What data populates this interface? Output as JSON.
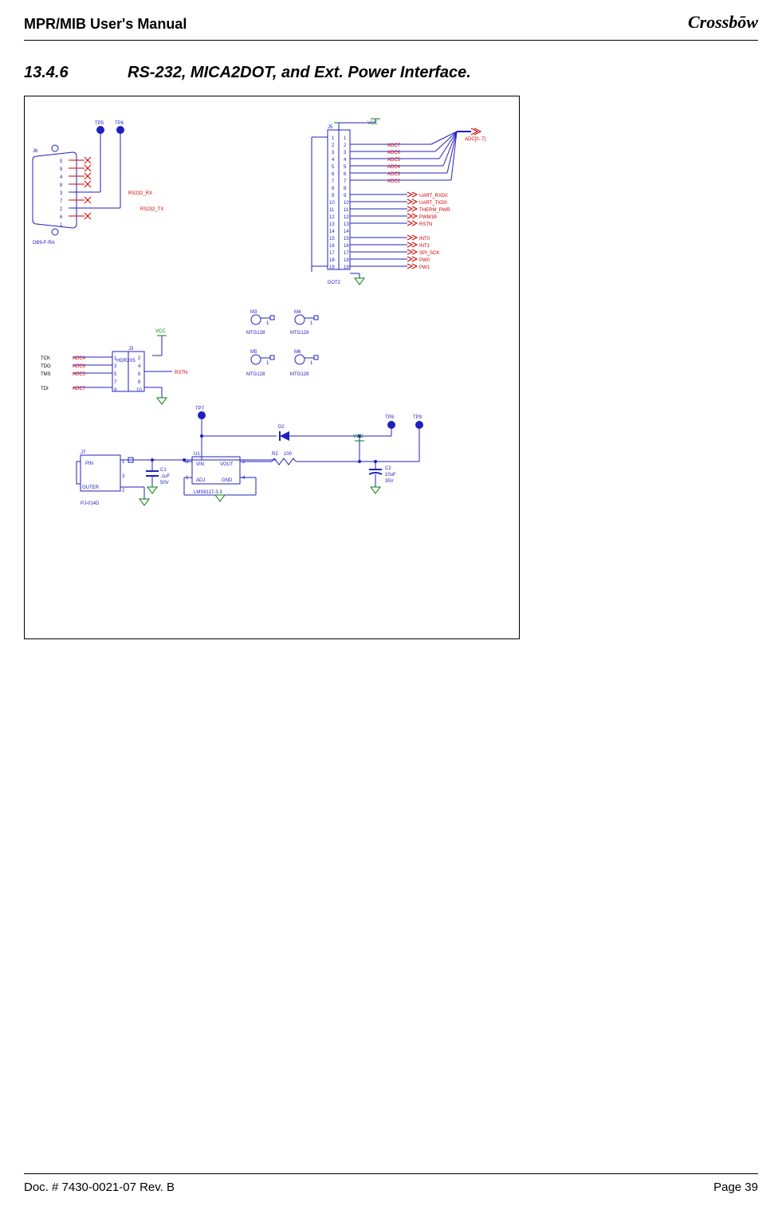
{
  "header": {
    "title": "MPR/MIB User's Manual",
    "logo": "Crossbōw"
  },
  "section": {
    "number": "13.4.6",
    "title": "RS-232, MICA2DOT, and Ext. Power Interface."
  },
  "footer": {
    "left": "Doc. # 7430-0021-07 Rev. B",
    "right": "Page 39"
  },
  "schematic": {
    "db9": {
      "ref": "J6",
      "partname": "DB9-F-RA",
      "pins": [
        "5",
        "9",
        "4",
        "8",
        "3",
        "7",
        "2",
        "6",
        "1"
      ]
    },
    "rs232": {
      "rx": "RS232_RX",
      "tx": "RS232_TX"
    },
    "tp": {
      "tp5": "TP5",
      "tp6": "TP6",
      "tp7": "TP7",
      "tp8": "TP8",
      "tp9": "TP9"
    },
    "j5": {
      "ref": "J5",
      "partname": "DOT2",
      "vcc": "VCC",
      "left_pins": [
        "1",
        "2",
        "3",
        "4",
        "5",
        "6",
        "7",
        "8",
        "9",
        "10",
        "11",
        "12",
        "13",
        "14",
        "15",
        "16",
        "17",
        "18",
        "19"
      ],
      "right_pins": [
        "1",
        "2",
        "3",
        "4",
        "5",
        "6",
        "7",
        "8",
        "9",
        "10",
        "11",
        "12",
        "13",
        "14",
        "15",
        "16",
        "17",
        "18",
        "19"
      ],
      "nets": {
        "adc7": "ADC7",
        "adc6": "ADC6",
        "adc5": "ADC5",
        "adc4": "ADC4",
        "adc3": "ADC3",
        "adc2": "ADC2",
        "uart_rxd0": "UART_RXD0",
        "uart_txd0": "UART_TXD0",
        "therm_pwr": "THERM_PWR",
        "pwm1b": "PWM1B",
        "rstn": "RSTN",
        "int0": "INT0",
        "int1": "INT1",
        "spi_sck": "SPI_SCK",
        "pw0": "PW0",
        "pw1": "PW1"
      },
      "bus": "ADC[0..7]"
    },
    "j3": {
      "ref": "J3",
      "partname": "HDR2X5",
      "vcc": "VCC",
      "jtag": {
        "tck": "TCK",
        "tdo": "TDO",
        "tms": "TMS",
        "tdi": "TDI"
      },
      "adc": {
        "adc4": "ADC4",
        "adc6": "ADC6",
        "adc5": "ADC5",
        "adc7": "ADC7"
      },
      "pins_l": [
        "1",
        "3",
        "5",
        "7",
        "9"
      ],
      "pins_r": [
        "2",
        "4",
        "6",
        "8",
        "10"
      ],
      "rstn": "RSTN"
    },
    "mtg": {
      "refs": [
        "M3",
        "M4",
        "M5",
        "M6"
      ],
      "part": "MTG128",
      "pin": "1"
    },
    "power": {
      "j7": {
        "ref": "J7",
        "partname": "PJ-014D",
        "pin_labels": {
          "pin": "PIN",
          "outer": "OUTER"
        },
        "pins": [
          "1",
          "3",
          "2"
        ]
      },
      "d2": {
        "ref": "D2"
      },
      "c1": {
        "ref": "C1",
        "val": ".1uF",
        "volt": "50V"
      },
      "u1": {
        "ref": "U1",
        "part": "LMS8117-3.3",
        "pins": {
          "vin": "VIN",
          "vout": "VOUT",
          "adj": "ADJ",
          "gnd": "GND"
        },
        "nums": {
          "vin": "3",
          "adj": "1",
          "vout": "2",
          "tab": "4"
        }
      },
      "r2": {
        "ref": "R2",
        "val": "100"
      },
      "c2": {
        "ref": "C2",
        "val": "10uF",
        "volt": "35V"
      },
      "vcc": "VCC"
    }
  }
}
